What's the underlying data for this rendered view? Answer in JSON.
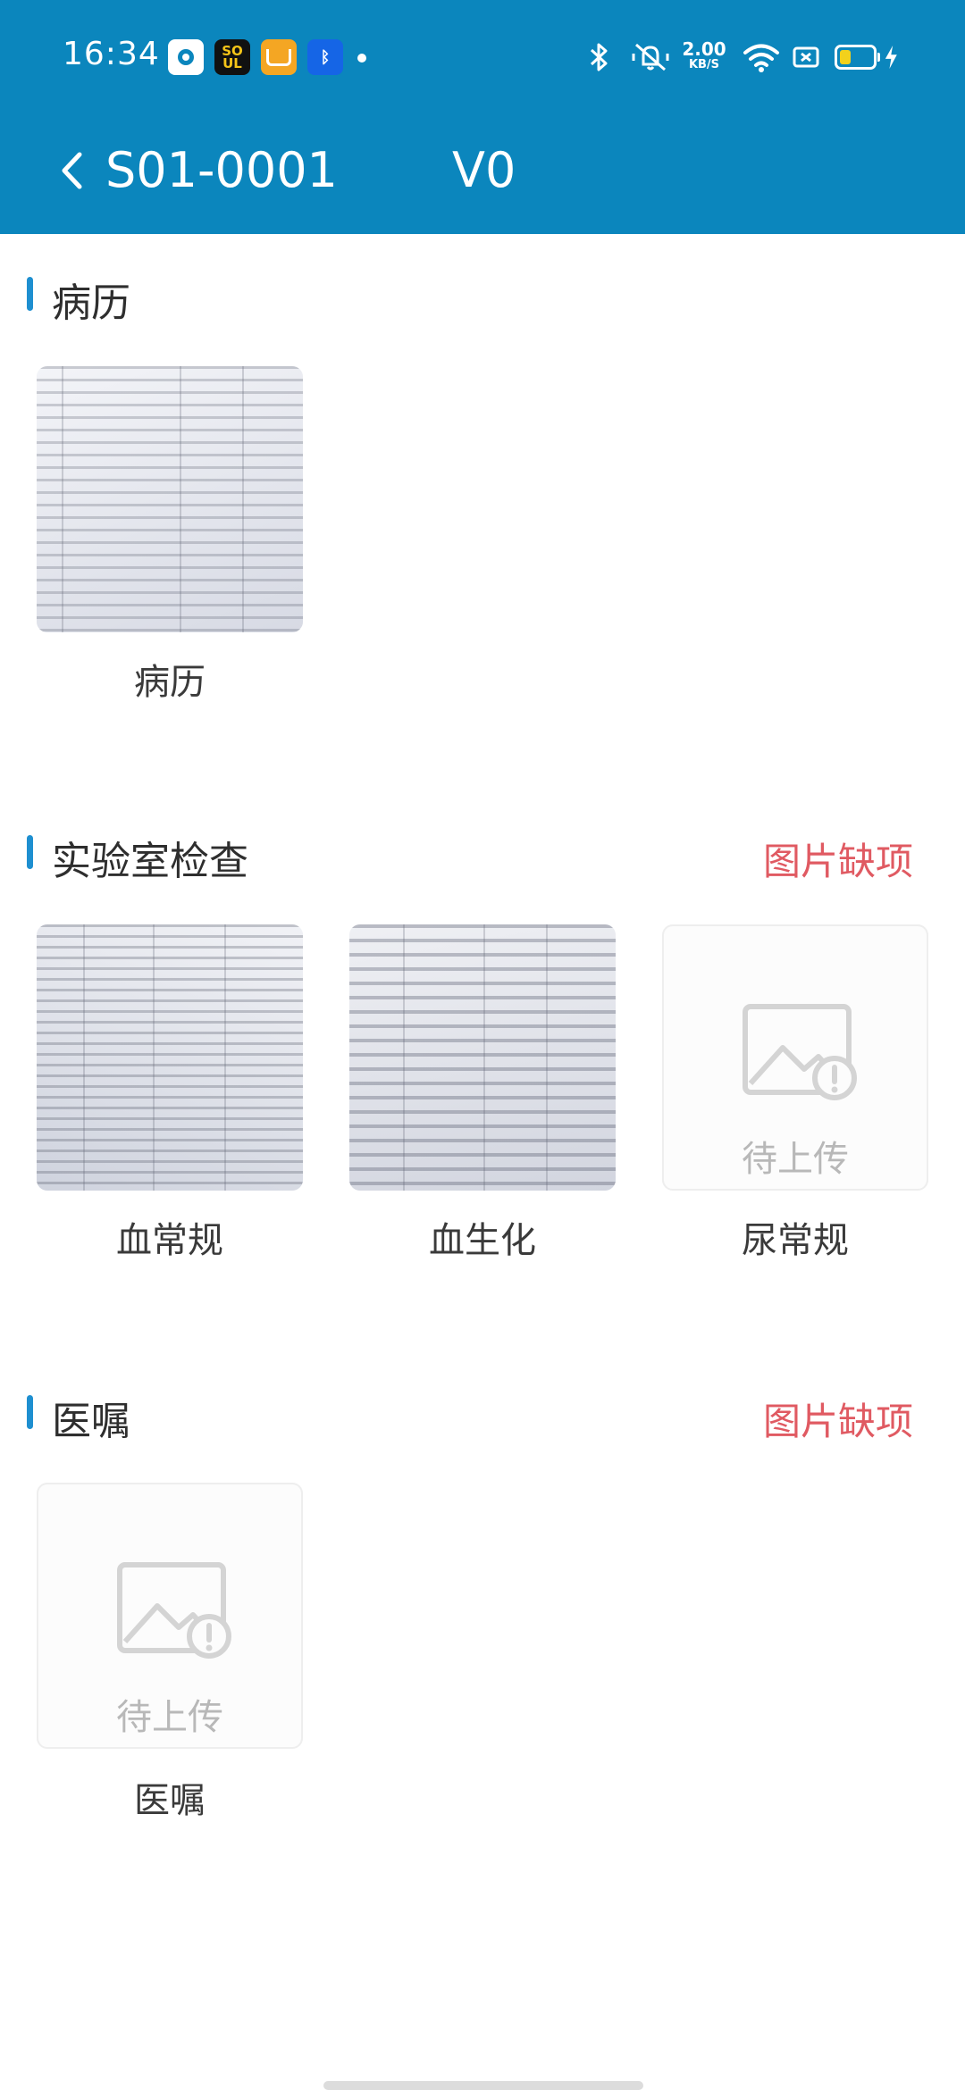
{
  "status_bar": {
    "time": "16:34",
    "notification_icons": [
      "circle-app-icon",
      "soul-app-icon",
      "shopping-app-icon",
      "bluetooth-app-icon"
    ],
    "network_speed_value": "2.00",
    "network_speed_unit": "KB/S",
    "battery_color": "#f2d11c"
  },
  "header": {
    "title": "S01-0001",
    "version": "V0",
    "background": "#0b86bd"
  },
  "sections": [
    {
      "title": "病历",
      "missing_label": "",
      "items": [
        {
          "label": "病历",
          "state": "uploaded"
        }
      ]
    },
    {
      "title": "实验室检查",
      "missing_label": "图片缺项",
      "items": [
        {
          "label": "血常规",
          "state": "uploaded"
        },
        {
          "label": "血生化",
          "state": "uploaded"
        },
        {
          "label": "尿常规",
          "state": "pending",
          "placeholder_text": "待上传"
        }
      ]
    },
    {
      "title": "医嘱",
      "missing_label": "图片缺项",
      "items": [
        {
          "label": "医嘱",
          "state": "pending",
          "placeholder_text": "待上传"
        }
      ]
    }
  ],
  "colors": {
    "accent": "#1e8fd0",
    "missing": "#e05a62"
  }
}
